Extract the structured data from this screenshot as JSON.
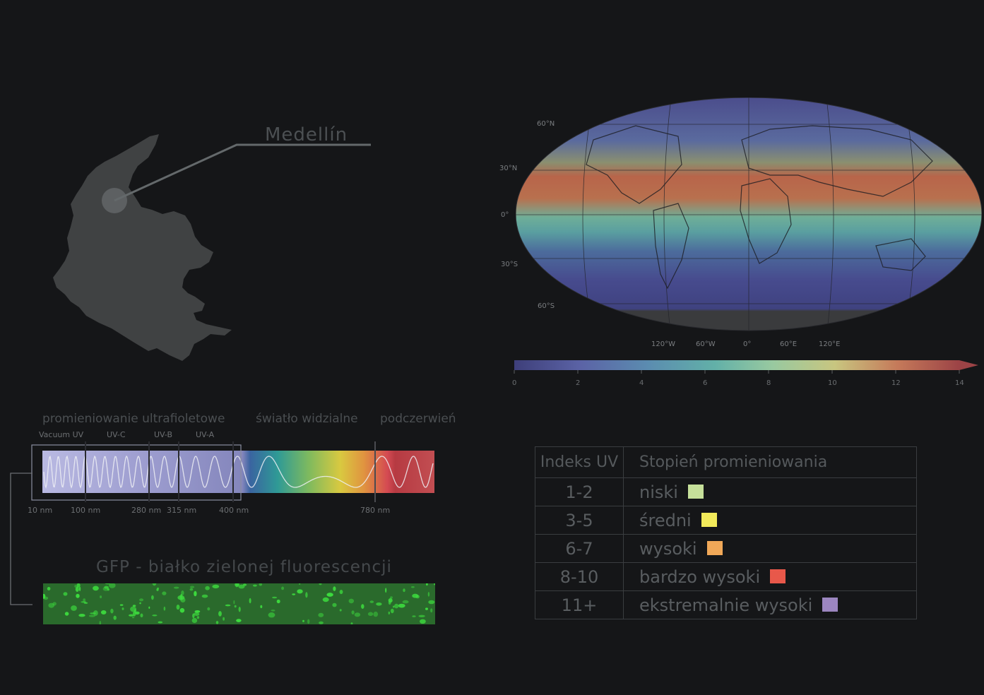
{
  "map_label": {
    "city": "Medellín"
  },
  "world_map": {
    "lat_labels": [
      "60°N",
      "30°N",
      "0°",
      "30°S",
      "60°S"
    ],
    "lon_labels": [
      "120°W",
      "60°W",
      "0°",
      "60°E",
      "120°E"
    ],
    "colorbar": {
      "ticks": [
        "0",
        "2",
        "4",
        "6",
        "8",
        "10",
        "12",
        "14"
      ],
      "range": [
        0,
        14
      ],
      "extend": "max"
    }
  },
  "spectrum": {
    "bands": {
      "uv": "promieniowanie ultrafioletowe",
      "visible": "światło widzialne",
      "ir": "podczerwień"
    },
    "sub_bands": [
      "Vacuum UV",
      "UV-C",
      "UV-B",
      "UV-A"
    ],
    "wavelengths": [
      "10 nm",
      "100 nm",
      "280 nm",
      "315 nm",
      "400 nm",
      "780 nm"
    ]
  },
  "gfp": {
    "title": "GFP - białko zielonej fluorescencji"
  },
  "uv_table": {
    "header": {
      "index": "Indeks UV",
      "level": "Stopień promieniowania"
    },
    "rows": [
      {
        "index": "1-2",
        "level": "niski",
        "color": "#c6e09a"
      },
      {
        "index": "3-5",
        "level": "średni",
        "color": "#f2ea5a"
      },
      {
        "index": "6-7",
        "level": "wysoki",
        "color": "#f0a858"
      },
      {
        "index": "8-10",
        "level": "bardzo wysoki",
        "color": "#e8584a"
      },
      {
        "index": "11+",
        "level": "ekstremalnie wysoki",
        "color": "#9c86c0"
      }
    ]
  },
  "colors": {
    "background": "#151618",
    "colombia_fill": "#404243",
    "gfp_green": "#33c43c"
  }
}
